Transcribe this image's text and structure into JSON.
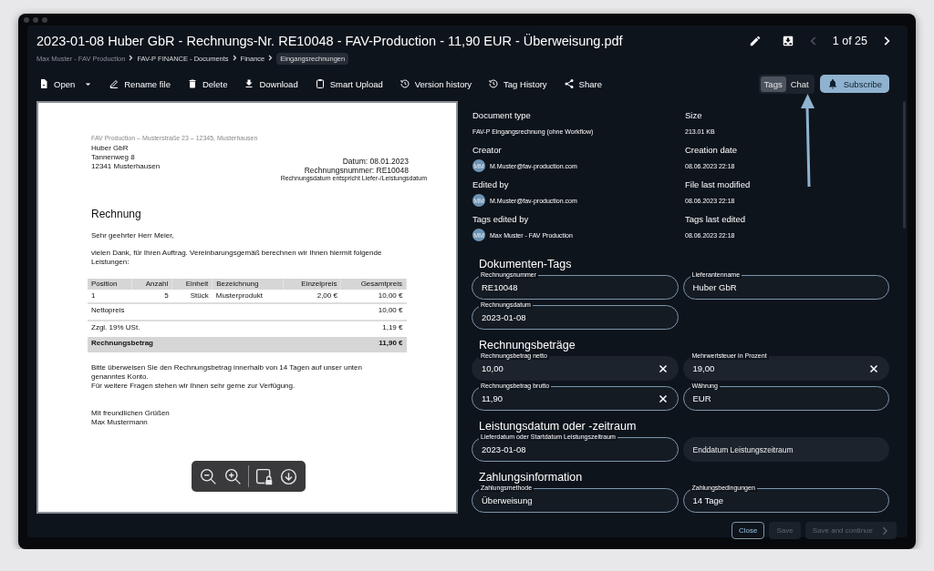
{
  "window": {
    "title": "2023-01-08 Huber GbR - Rechnungs-Nr. RE10048 - FAV-Production - 11,90 EUR - Überweisung.pdf"
  },
  "breadcrumb": [
    {
      "label": "Max Muster - FAV Production",
      "current": false
    },
    {
      "label": "FAV-P FINANCE - Documents",
      "current": false
    },
    {
      "label": "Finance",
      "current": false
    },
    {
      "label": "Eingangsrechnungen",
      "current": true
    }
  ],
  "pager": {
    "text": "1 of 25",
    "prev_disabled": true
  },
  "toolbar": [
    {
      "kind": "open",
      "label": "Open",
      "menu": true
    },
    {
      "kind": "rename",
      "label": "Rename file",
      "menu": false
    },
    {
      "kind": "delete",
      "label": "Delete",
      "menu": false
    },
    {
      "kind": "download",
      "label": "Download",
      "menu": false
    },
    {
      "kind": "upload",
      "label": "Smart Upload",
      "menu": false
    },
    {
      "kind": "history",
      "label": "Version history",
      "menu": false
    },
    {
      "kind": "history",
      "label": "Tag History",
      "menu": false
    },
    {
      "kind": "share",
      "label": "Share",
      "menu": false
    }
  ],
  "panel_tabs": [
    {
      "label": "Tags",
      "selected": true
    },
    {
      "label": "Chat",
      "selected": false
    }
  ],
  "subscribe": {
    "label": "Subscribe"
  },
  "document": {
    "sender_line": "FAV Production – Musterstraße 23 – 12345, Musterhausen",
    "recipient": [
      "Huber GbR",
      "Tannenweg 8",
      "12341 Musterhausen"
    ],
    "meta": [
      "Datum: 08.01.2023",
      "Rechnungsnummer: RE10048"
    ],
    "meta_note": "Rechnungsdatum entspricht Liefer-/Leistungsdatum",
    "heading": "Rechnung",
    "paragraphs": [
      "Sehr geehrter Herr Meier,",
      "vielen Dank, für Ihren Auftrag. Vereinbarungsgemäß berechnen wir Ihnen hiermit folgende Leistungen:"
    ],
    "table": {
      "columns": [
        "Position",
        "Anzahl",
        "Einheit",
        "Bezeichnung",
        "Einzelpreis",
        "Gesamtpreis"
      ],
      "rows": [
        [
          "1",
          "5",
          "Stück",
          "Musterprodukt",
          "2,00 €",
          "10,00 €"
        ]
      ],
      "totals": [
        {
          "label": "Nettopreis",
          "value": "10,00 €",
          "emphasis": false
        },
        {
          "label": "Zzgl. 19% USt.",
          "value": "1,19 €",
          "emphasis": false
        },
        {
          "label": "Rechnungsbetrag",
          "value": "11,90 €",
          "emphasis": true
        }
      ]
    },
    "closing": [
      "Bitte überweisen Sie den Rechnungsbetrag innerhalb von 14 Tagen auf unser unten genanntes Konto.",
      "Für weitere Fragen stehen wir Ihnen sehr gerne zur Verfügung."
    ],
    "signoff": [
      "Mit freundlichen Grüßen",
      "Max Mustermann"
    ]
  },
  "info": [
    {
      "label": "Document type",
      "value": "FAV-P Eingangsrechnung (ohne Workflow)"
    },
    {
      "label": "Size",
      "value": "213.01 KB"
    },
    {
      "label": "Creator",
      "value": "M.Muster@fav-production.com",
      "avatar": "MM"
    },
    {
      "label": "Creation date",
      "value": "08.06.2023 22:18"
    },
    {
      "label": "Edited by",
      "value": "M.Muster@fav-production.com",
      "avatar": "MM"
    },
    {
      "label": "File last modified",
      "value": "08.06.2023 22:18"
    },
    {
      "label": "Tags edited by",
      "value": "Max Muster - FAV Production",
      "avatar": "MM"
    },
    {
      "label": "Tags last edited",
      "value": "08.06.2023 22:18"
    }
  ],
  "sections": [
    {
      "title": "Dokumenten-Tags",
      "fields": [
        {
          "label": "Rechnungsnummer",
          "value": "RE10048",
          "outlined": true,
          "clearable": false
        },
        {
          "label": "Lieferantenname",
          "value": "Huber GbR",
          "outlined": true,
          "clearable": false
        },
        {
          "label": "Rechnungsdatum",
          "value": "2023-01-08",
          "outlined": true,
          "clearable": false
        }
      ]
    },
    {
      "title": "Rechnungsbeträge",
      "fields": [
        {
          "label": "Rechnungsbetrag netto",
          "value": "10,00",
          "outlined": false,
          "clearable": true
        },
        {
          "label": "Mehrwertsteuer in Prozent",
          "value": "19,00",
          "outlined": false,
          "clearable": true
        },
        {
          "label": "Rechnungsbetrag brutto",
          "value": "11,90",
          "outlined": true,
          "clearable": true
        },
        {
          "label": "Währung",
          "value": "EUR",
          "outlined": true,
          "clearable": false
        }
      ]
    },
    {
      "title": "Leistungsdatum oder -zeitraum",
      "fields": [
        {
          "label": "Lieferdatum oder Startdatum Leistungszeitraum",
          "value": "2023-01-08",
          "outlined": true,
          "clearable": false
        },
        {
          "placeholder": "Enddatum Leistungszeitraum",
          "outlined": false,
          "clearable": false
        }
      ]
    },
    {
      "title": "Zahlungsinformation",
      "fields": [
        {
          "label": "Zahlungsmethode",
          "value": "Überweisung",
          "outlined": true,
          "clearable": false
        },
        {
          "label": "Zahlungsbedingungen",
          "value": "14 Tage",
          "outlined": true,
          "clearable": false
        }
      ]
    }
  ],
  "footer": [
    {
      "label": "Close",
      "disabled": false
    },
    {
      "label": "Save",
      "disabled": true
    },
    {
      "label": "Save and continue",
      "disabled": true,
      "chevron": true
    }
  ]
}
